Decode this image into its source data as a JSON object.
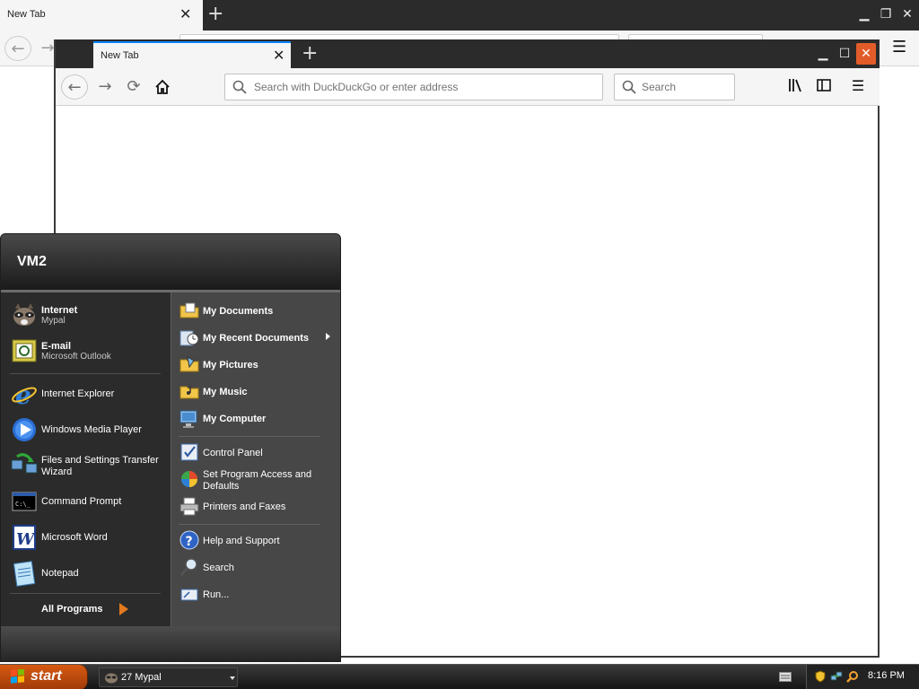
{
  "back_window": {
    "tab_title": "New Tab",
    "new_tab_symbol": "+",
    "menu_icon": "hamburger-menu-icon"
  },
  "front_window": {
    "tab_title": "New Tab",
    "new_tab_symbol": "+",
    "address_placeholder": "Search with DuckDuckGo or enter address",
    "search_placeholder": "Search",
    "toolbar_icons": [
      "back-arrow-icon",
      "forward-arrow-icon",
      "reload-icon",
      "home-icon",
      "library-icon",
      "sidebar-icon",
      "hamburger-menu-icon"
    ],
    "window_controls": [
      "minimize-icon",
      "maximize-icon",
      "close-icon"
    ],
    "close_button_color": "#e25c2a"
  },
  "start_menu": {
    "user_name": "VM2",
    "pinned": [
      {
        "title": "Internet",
        "subtitle": "Mypal"
      },
      {
        "title": "E-mail",
        "subtitle": "Microsoft Outlook"
      }
    ],
    "recent": [
      {
        "title": "Internet Explorer"
      },
      {
        "title": "Windows Media Player"
      },
      {
        "title_line1": "Files and Settings Transfer",
        "title_line2": "Wizard"
      },
      {
        "title": "Command Prompt"
      },
      {
        "title": "Microsoft Word"
      },
      {
        "title": "Notepad"
      }
    ],
    "all_programs": "All Programs",
    "places": [
      {
        "title": "My Documents"
      },
      {
        "title": "My Recent Documents"
      },
      {
        "title": "My Pictures"
      },
      {
        "title": "My Music"
      },
      {
        "title": "My Computer"
      }
    ],
    "settings": [
      {
        "title": "Control Panel"
      },
      {
        "title_line1": "Set Program Access and",
        "title_line2": "Defaults"
      },
      {
        "title": "Printers and Faxes"
      }
    ],
    "help": [
      {
        "title": "Help and Support"
      },
      {
        "title": "Search"
      },
      {
        "title": "Run..."
      }
    ]
  },
  "taskbar": {
    "start_label": "start",
    "task_label": "27 Mypal",
    "clock": "8:16 PM",
    "accent_color": "#d65a12"
  }
}
